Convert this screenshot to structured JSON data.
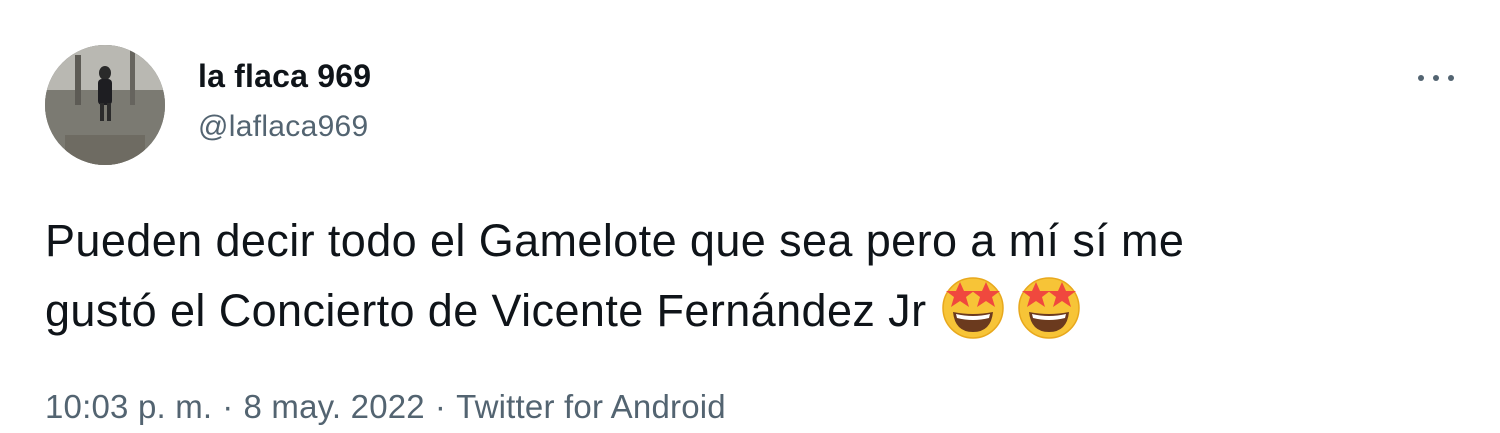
{
  "user": {
    "display_name": "la flaca 969",
    "handle": "@laflaca969"
  },
  "tweet": {
    "text_line1": "Pueden decir todo el Gamelote que sea pero a mí sí me",
    "text_line2": "gustó el Concierto de Vicente Fernández Jr",
    "emojis": [
      "star-struck-emoji",
      "star-struck-emoji"
    ]
  },
  "meta": {
    "time": "10:03 p. m.",
    "separator": "·",
    "date": "8 may. 2022",
    "source": "Twitter for Android"
  },
  "icons": {
    "more": "more-options-icon"
  },
  "colors": {
    "text_primary": "#0f1419",
    "text_secondary": "#536471",
    "background": "#ffffff"
  }
}
